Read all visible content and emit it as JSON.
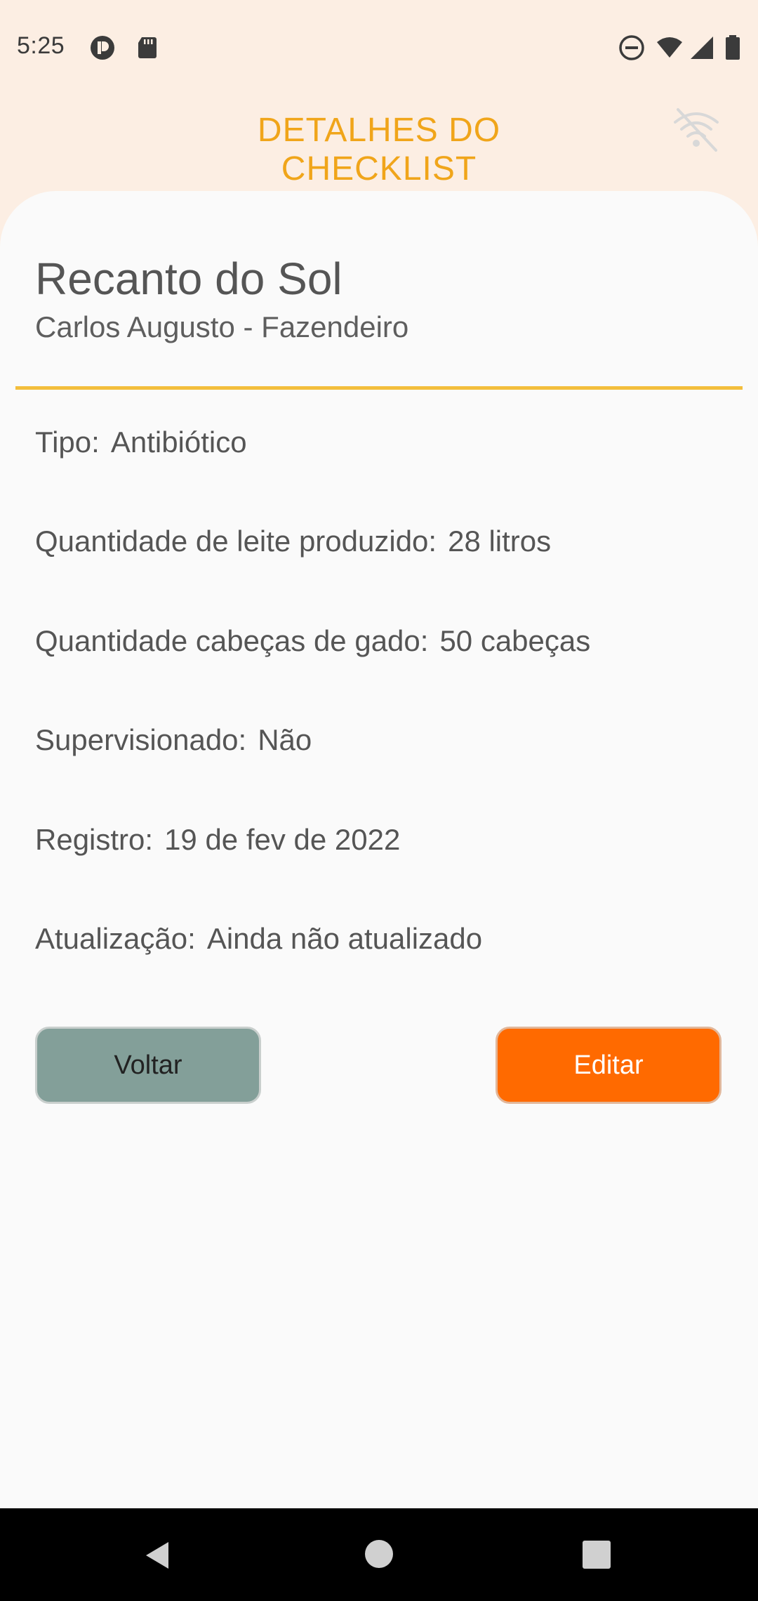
{
  "status_bar": {
    "time": "5:25",
    "icons": [
      "app-notification-icon",
      "sd-card-icon",
      "do-not-disturb-icon",
      "wifi-icon",
      "cell-signal-icon",
      "battery-icon"
    ]
  },
  "header": {
    "title": "DETALHES DO CHECKLIST",
    "offline_icon": "wifi-off-icon"
  },
  "checklist": {
    "farm_name": "Recanto do Sol",
    "owner": "Carlos Augusto - Fazendeiro",
    "details": [
      {
        "label": "Tipo:",
        "value": "Antibiótico"
      },
      {
        "label": "Quantidade de leite produzido:",
        "value": "28 litros"
      },
      {
        "label": "Quantidade cabeças de gado:",
        "value": "50 cabeças"
      },
      {
        "label": "Supervisionado:",
        "value": "Não"
      },
      {
        "label": "Registro:",
        "value": "19 de fev de 2022"
      },
      {
        "label": "Atualização:",
        "value": "Ainda não atualizado"
      }
    ]
  },
  "actions": {
    "back_label": "Voltar",
    "edit_label": "Editar"
  },
  "colors": {
    "accent": "#f0a51a",
    "divider": "#f3be3c",
    "back_button": "#839f99",
    "edit_button": "#ff6a00",
    "header_bg": "#fceee3"
  }
}
